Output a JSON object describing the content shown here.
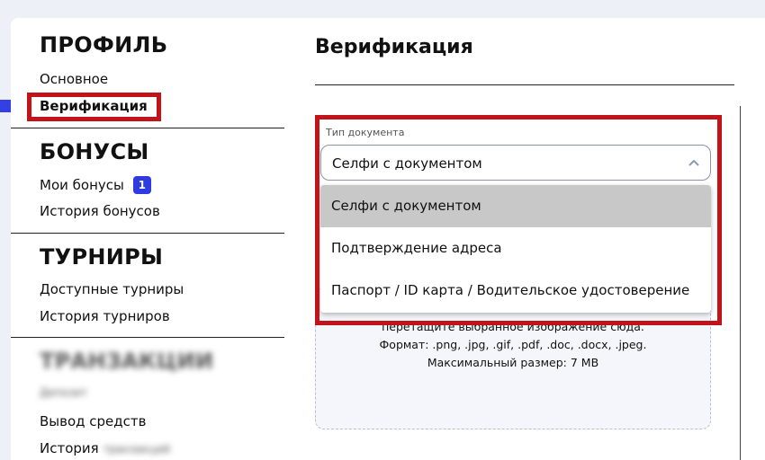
{
  "sidebar": {
    "sections": [
      {
        "title": "ПРОФИЛЬ",
        "items": [
          {
            "label": "Основное"
          },
          {
            "label": "Верификация",
            "active": true
          }
        ]
      },
      {
        "title": "БОНУСЫ",
        "items": [
          {
            "label": "Мои бонусы",
            "badge": "1"
          },
          {
            "label": "История бонусов"
          }
        ]
      },
      {
        "title": "ТУРНИРЫ",
        "items": [
          {
            "label": "Доступные турниры"
          },
          {
            "label": "История турниров"
          }
        ]
      },
      {
        "title": "ТРАНЗАКЦИИ",
        "items": [
          {
            "label": "Депозит"
          },
          {
            "label": "Вывод средств"
          },
          {
            "label": "История",
            "suffix": "транзакций"
          }
        ]
      }
    ]
  },
  "main": {
    "title": "Верификация",
    "doc_select": {
      "label": "Тип документа",
      "value": "Селфи с документом",
      "options": [
        "Селфи с документом",
        "Подтверждение адреса",
        "Паспорт / ID карта / Водительское удостоверение"
      ],
      "selected_index": 0
    },
    "dropzone": {
      "line1": "перетащите выбранное изображение сюда.",
      "line2": "Формат: .png, .jpg, .gif, .pdf, .doc, .docx, .jpeg.",
      "line3": "Максимальный размер: 7 MB"
    }
  },
  "colors": {
    "accent": "#2f3ae0",
    "highlight": "#c2131a",
    "selected_option": "#c8c8c8"
  },
  "icons": {
    "select_chevron": "chevron-up-icon"
  }
}
